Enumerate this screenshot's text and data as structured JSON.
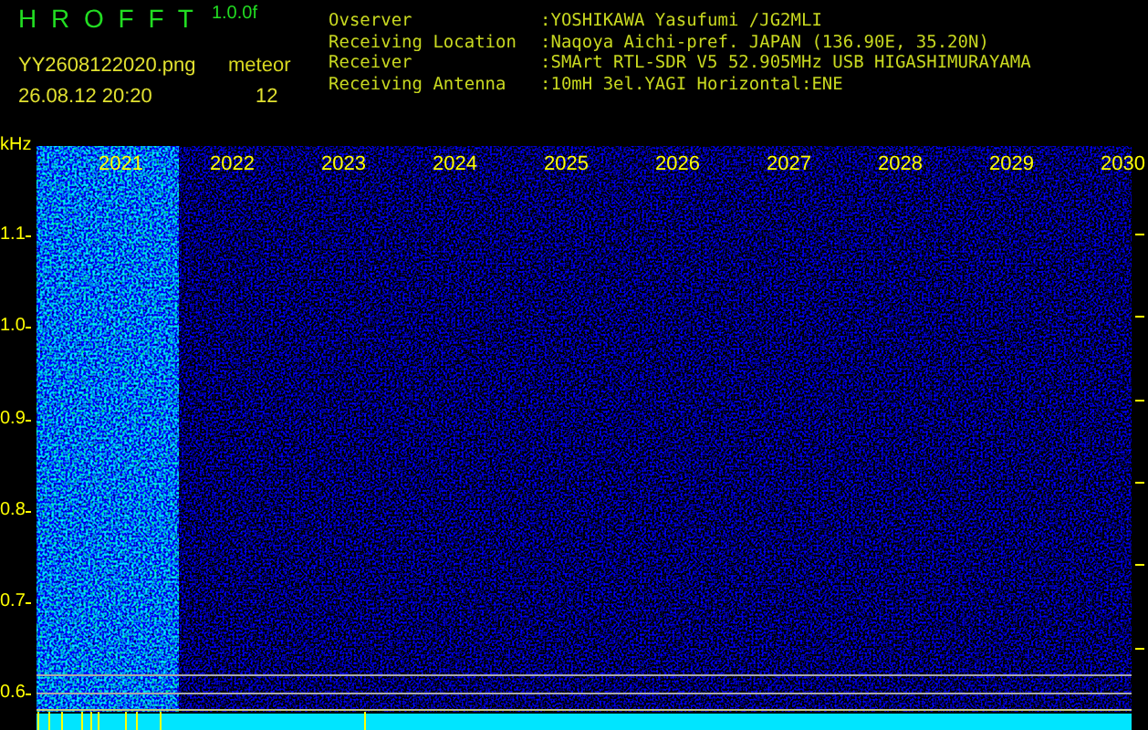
{
  "app": {
    "title": "H R O F F T",
    "version": "1.0.0f",
    "file": "YY2608122020.png",
    "timestamp": "26.08.12 20:20",
    "counter_label": "meteor",
    "counter_value": "12"
  },
  "station": [
    {
      "label": "Ovserver",
      "value": ":YOSHIKAWA Yasufumi /JG2MLI"
    },
    {
      "label": "Receiving Location",
      "value": ":Naqoya Aichi-pref. JAPAN (136.90E, 35.20N)"
    },
    {
      "label": "Receiver",
      "value": ":SMArt RTL-SDR V5 52.905MHz USB HIGASHIMURAYAMA"
    },
    {
      "label": "Receiving Antenna",
      "value": ":10mH 3el.YAGI Horizontal:ENE"
    }
  ],
  "spectrogram": {
    "y_unit": "kHz",
    "y_labels": [
      "1.1",
      "1.0",
      "0.9",
      "0.8",
      "0.7",
      "0.6"
    ],
    "x_labels": [
      "2021",
      "2022",
      "2023",
      "2024",
      "2025",
      "2026",
      "2027",
      "2028",
      "2029",
      "2030"
    ]
  }
}
